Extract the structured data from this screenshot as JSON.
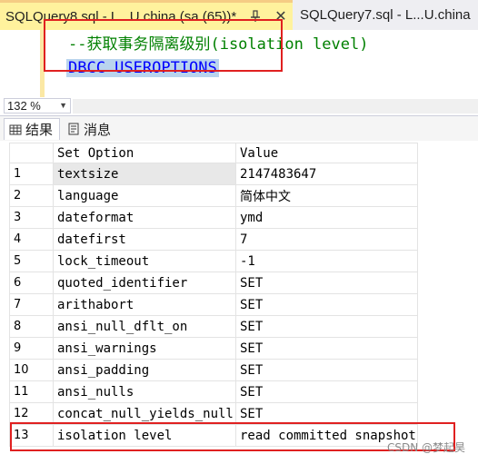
{
  "tabs": [
    {
      "label": "SQLQuery8.sql - L...U.china (sa (65))*",
      "active": true
    },
    {
      "label": "SQLQuery7.sql - L...U.china",
      "active": false
    }
  ],
  "tab_close_glyph": "✕",
  "editor": {
    "comment": "--获取事务隔离级别(isolation level)",
    "statement": "DBCC USEROPTIONS"
  },
  "zoom": {
    "value": "132 %"
  },
  "result_tabs": {
    "results": "结果",
    "messages": "消息"
  },
  "grid": {
    "columns": [
      "Set Option",
      "Value"
    ],
    "rows": [
      {
        "n": "1",
        "option": "textsize",
        "value": "2147483647"
      },
      {
        "n": "2",
        "option": "language",
        "value": "简体中文"
      },
      {
        "n": "3",
        "option": "dateformat",
        "value": "ymd"
      },
      {
        "n": "4",
        "option": "datefirst",
        "value": "7"
      },
      {
        "n": "5",
        "option": "lock_timeout",
        "value": "-1"
      },
      {
        "n": "6",
        "option": "quoted_identifier",
        "value": "SET"
      },
      {
        "n": "7",
        "option": "arithabort",
        "value": "SET"
      },
      {
        "n": "8",
        "option": "ansi_null_dflt_on",
        "value": "SET"
      },
      {
        "n": "9",
        "option": "ansi_warnings",
        "value": "SET"
      },
      {
        "n": "10",
        "option": "ansi_padding",
        "value": "SET"
      },
      {
        "n": "11",
        "option": "ansi_nulls",
        "value": "SET"
      },
      {
        "n": "12",
        "option": "concat_null_yields_null",
        "value": "SET"
      },
      {
        "n": "13",
        "option": "isolation level",
        "value": "read committed snapshot"
      }
    ]
  },
  "watermark": "CSDN @梦起昊",
  "colors": {
    "active_tab": "#fff29d",
    "comment": "#008000",
    "keyword": "#0000ff",
    "selection": "#b9d4ee",
    "highlight_box": "#e02020"
  }
}
